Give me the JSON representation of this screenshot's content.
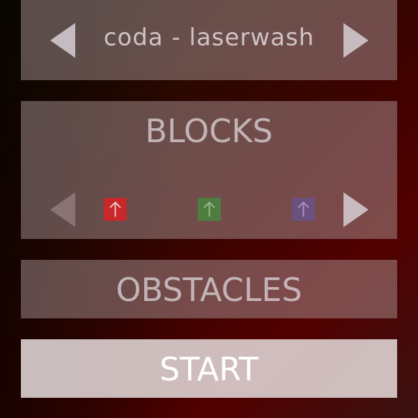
{
  "song_selector": {
    "title": "coda - laserwash",
    "prev_icon": "triangle-left-icon",
    "next_icon": "triangle-right-icon"
  },
  "blocks": {
    "title": "BLOCKS",
    "prev_icon": "triangle-left-icon",
    "next_icon": "triangle-right-icon",
    "items": [
      {
        "color": "#c8282a",
        "arrow_color": "#f0c0c0",
        "icon": "up-arrow-icon"
      },
      {
        "color": "#4e7d40",
        "arrow_color": "#9ab68a",
        "icon": "up-arrow-icon"
      },
      {
        "color": "#6b5080",
        "arrow_color": "#a893b8",
        "icon": "up-arrow-icon"
      }
    ]
  },
  "obstacles": {
    "title": "OBSTACLES"
  },
  "start": {
    "label": "START"
  }
}
